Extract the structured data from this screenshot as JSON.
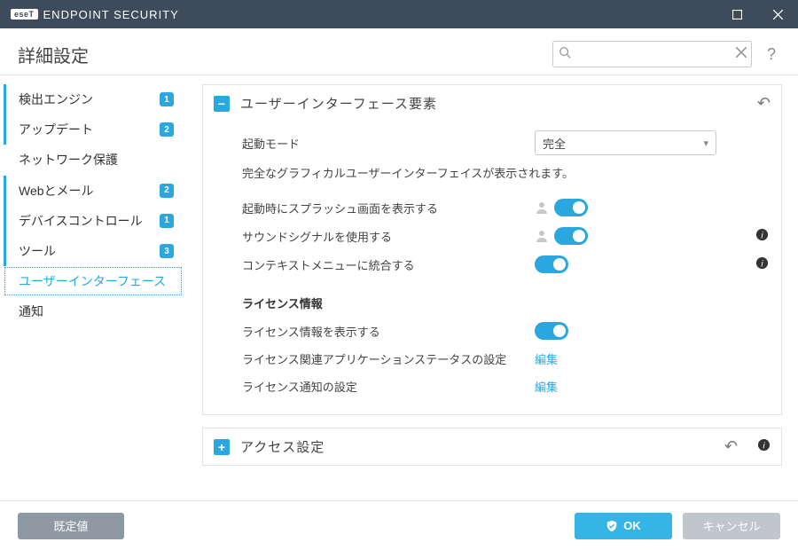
{
  "titlebar": {
    "brand_badge": "eseT",
    "brand_text": "ENDPOINT SECURITY"
  },
  "header": {
    "title": "詳細設定",
    "search_placeholder": "",
    "help": "?"
  },
  "sidebar": {
    "items": [
      {
        "label": "検出エンジン",
        "badge": "1",
        "accent": true
      },
      {
        "label": "アップデート",
        "badge": "2",
        "accent": true
      },
      {
        "label": "ネットワーク保護",
        "badge": "",
        "accent": false
      },
      {
        "label": "Webとメール",
        "badge": "2",
        "accent": true
      },
      {
        "label": "デバイスコントロール",
        "badge": "1",
        "accent": true
      },
      {
        "label": "ツール",
        "badge": "3",
        "accent": true
      },
      {
        "label": "ユーザーインターフェース",
        "badge": "",
        "selected": true
      },
      {
        "label": "通知",
        "badge": "",
        "accent": false
      }
    ]
  },
  "main": {
    "section_ui": {
      "title": "ユーザーインターフェース要素",
      "startup_mode_label": "起動モード",
      "startup_mode_value": "完全",
      "startup_mode_desc": "完全なグラフィカルユーザーインターフェイスが表示されます。",
      "rows": {
        "splash": "起動時にスプラッシュ画面を表示する",
        "sound": "サウンドシグナルを使用する",
        "context": "コンテキストメニューに統合する"
      },
      "license_heading": "ライセンス情報",
      "license_show": "ライセンス情報を表示する",
      "license_app_status": "ライセンス関連アプリケーションステータスの設定",
      "license_notice": "ライセンス通知の設定",
      "edit_link": "編集"
    },
    "section_access": {
      "title": "アクセス設定"
    }
  },
  "footer": {
    "defaults": "既定値",
    "ok": "OK",
    "cancel": "キャンセル"
  },
  "colors": {
    "accent": "#2aa7de",
    "titlebar": "#3d4b5b"
  }
}
